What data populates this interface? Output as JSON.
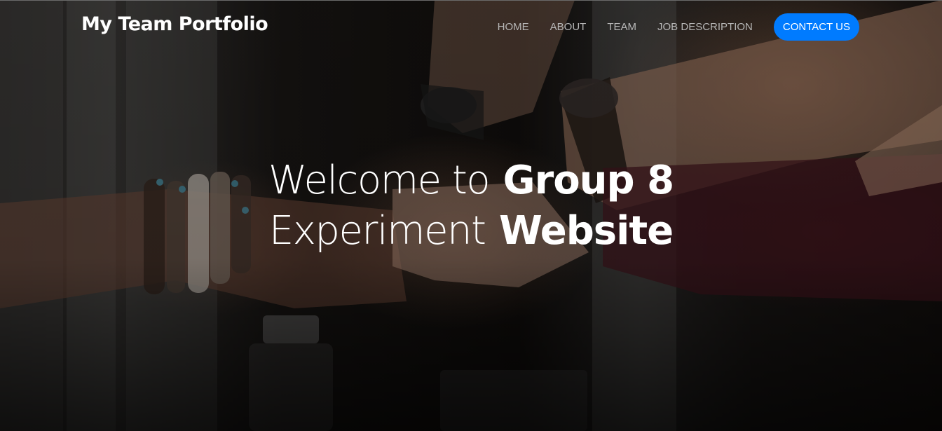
{
  "navbar": {
    "brand": "My Team Portfolio",
    "links": [
      {
        "label": "HOME"
      },
      {
        "label": "ABOUT"
      },
      {
        "label": "TEAM"
      },
      {
        "label": "JOB DESCRIPTION"
      }
    ],
    "cta_label": "CONTACT US"
  },
  "hero": {
    "line1_light": "Welcome to",
    "line1_bold": "Group 8",
    "line2_light": "Experiment",
    "line2_bold": "Website",
    "image_description": "hands fist-bump team photo"
  },
  "colors": {
    "accent": "#007bff",
    "nav_text": "#b7b7b7",
    "text": "#ffffff"
  }
}
